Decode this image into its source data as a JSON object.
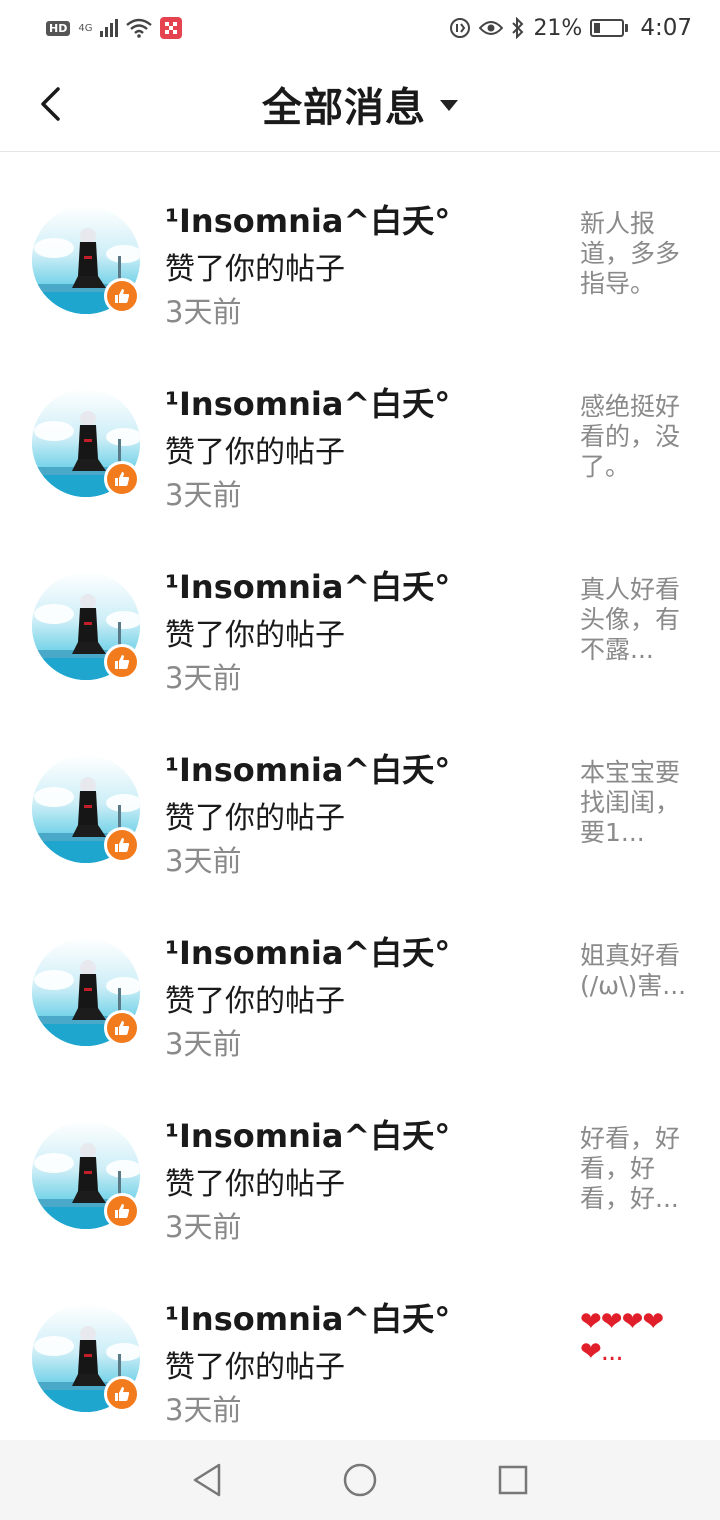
{
  "status_bar": {
    "hd": "HD",
    "network": "4G",
    "battery_percent": "21%",
    "battery_level": 0.21,
    "time": "4:07"
  },
  "header": {
    "title": "全部消息"
  },
  "notifications": [
    {
      "name": "¹Insomnia^白夭°",
      "action": "赞了你的帖子",
      "time": "3天前",
      "preview": "新人报道，多多指导。"
    },
    {
      "name": "¹Insomnia^白夭°",
      "action": "赞了你的帖子",
      "time": "3天前",
      "preview": "感绝挺好看的，没了。"
    },
    {
      "name": "¹Insomnia^白夭°",
      "action": "赞了你的帖子",
      "time": "3天前",
      "preview": "真人好看头像，有不露..."
    },
    {
      "name": "¹Insomnia^白夭°",
      "action": "赞了你的帖子",
      "time": "3天前",
      "preview": "本宝宝要找闺闺，要1..."
    },
    {
      "name": "¹Insomnia^白夭°",
      "action": "赞了你的帖子",
      "time": "3天前",
      "preview": "姐真好看(/ω\\)害..."
    },
    {
      "name": "¹Insomnia^白夭°",
      "action": "赞了你的帖子",
      "time": "3天前",
      "preview": "好看，好看，好看，好..."
    },
    {
      "name": "¹Insomnia^白夭°",
      "action": "赞了你的帖子",
      "time": "3天前",
      "preview": "❤❤❤❤❤..."
    }
  ],
  "colors": {
    "like_badge": "#f27b1e",
    "preview_text": "#8a8a8a",
    "heart": "#e01f2a"
  }
}
